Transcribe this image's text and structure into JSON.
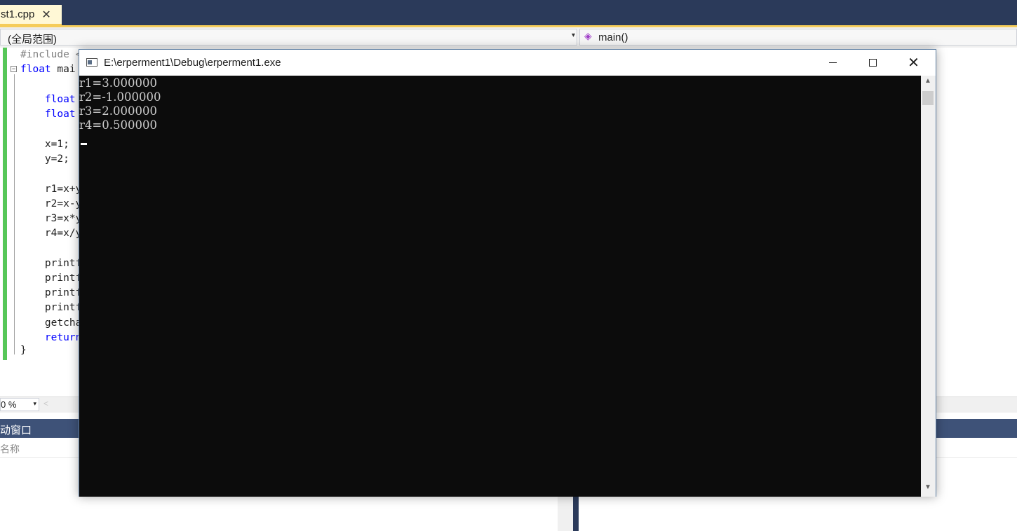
{
  "ide": {
    "tab": {
      "filename": "st1.cpp",
      "close_glyph": "✕"
    },
    "scope": {
      "value": "(全局范围)",
      "chevron": "▾"
    },
    "member": {
      "icon_glyph": "◈",
      "value": "main()"
    },
    "fold_glyph": "−",
    "code_lines": [
      {
        "kind": "pp",
        "text": "#include <"
      },
      {
        "kind": "kw",
        "text": "float",
        "rest": " mai"
      },
      {
        "kind": "kw",
        "text": "    float"
      },
      {
        "kind": "kw",
        "text": "    float"
      },
      {
        "kind": "plain",
        "text": "    x=1;"
      },
      {
        "kind": "plain",
        "text": "    y=2;"
      },
      {
        "kind": "plain",
        "text": "    r1=x+y"
      },
      {
        "kind": "plain",
        "text": "    r2=x-y"
      },
      {
        "kind": "plain",
        "text": "    r3=x*y"
      },
      {
        "kind": "plain",
        "text": "    r4=x/y"
      },
      {
        "kind": "plain",
        "text": "    printf"
      },
      {
        "kind": "plain",
        "text": "    printf"
      },
      {
        "kind": "plain",
        "text": "    printf"
      },
      {
        "kind": "plain",
        "text": "    printf"
      },
      {
        "kind": "plain",
        "text": "    getcha"
      },
      {
        "kind": "kw",
        "text": "    return"
      },
      {
        "kind": "plain",
        "text": "}"
      }
    ],
    "zoom": {
      "value": "0 %",
      "chevron": "▾"
    },
    "scroll_left_glyph": "<",
    "auto_panel": {
      "title": "动窗口",
      "column_name": "名称"
    }
  },
  "console": {
    "title": "E:\\erperment1\\Debug\\erperment1.exe",
    "close_glyph": "✕",
    "output": [
      "r1=3.000000",
      "r2=-1.000000",
      "r3=2.000000",
      "r4=0.500000"
    ],
    "scroll_up_glyph": "▲",
    "scroll_down_glyph": "▼"
  },
  "colors": {
    "ide_title_bg": "#2b3a5a",
    "tab_accent": "#f5cc5a",
    "keyword": "#0000ff",
    "change_bar": "#57c758",
    "console_bg": "#0c0c0c",
    "console_text": "#cccccc"
  }
}
